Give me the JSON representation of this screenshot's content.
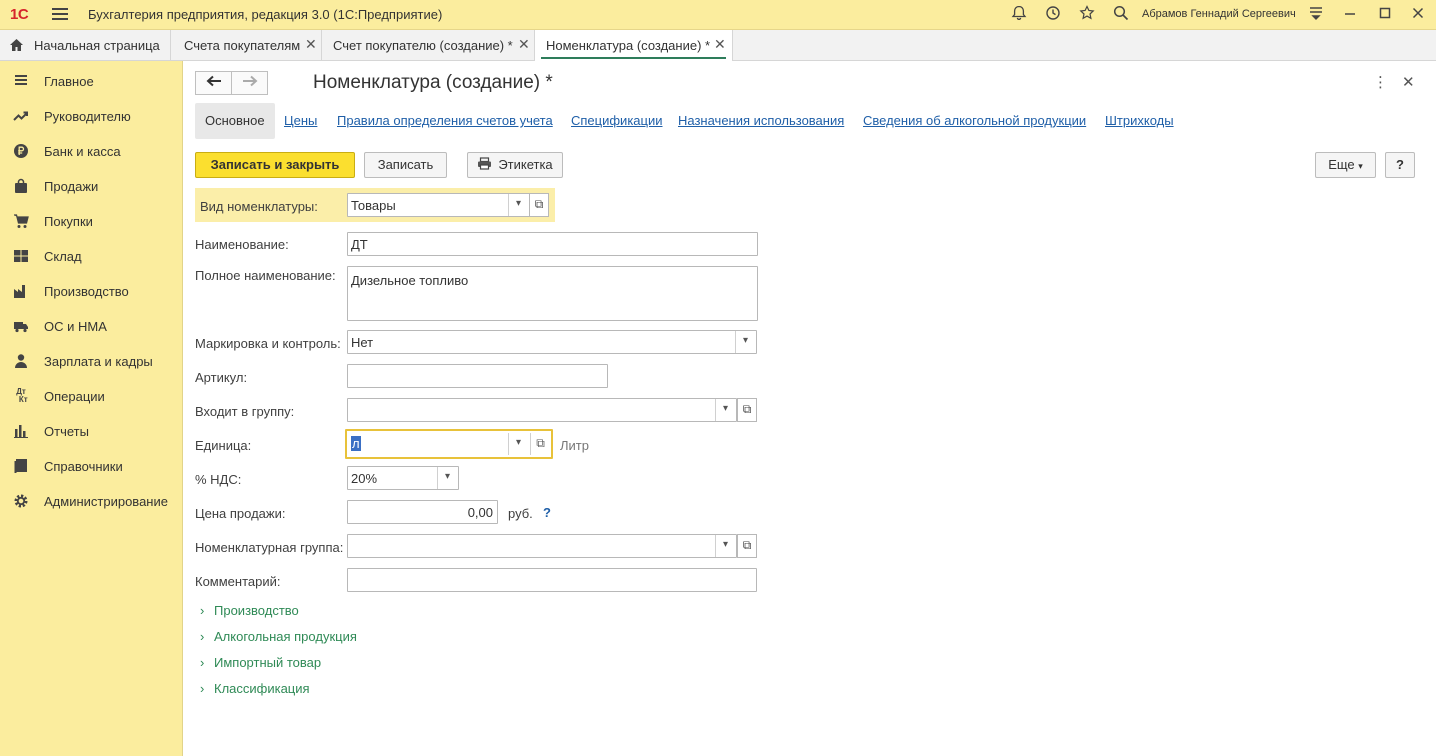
{
  "app": {
    "logo": "1С",
    "title": "Бухгалтерия предприятия, редакция 3.0  (1С:Предприятие)",
    "user": "Абрамов Геннадий Сергеевич"
  },
  "tabs": [
    {
      "label": "Начальная страница"
    },
    {
      "label": "Счета покупателям"
    },
    {
      "label": "Счет покупателю (создание) *"
    },
    {
      "label": "Номенклатура (создание) *"
    }
  ],
  "sidebar": {
    "items": [
      {
        "label": "Главное",
        "icon": "menu-icon"
      },
      {
        "label": "Руководителю",
        "icon": "trend-icon"
      },
      {
        "label": "Банк и касса",
        "icon": "ruble-icon"
      },
      {
        "label": "Продажи",
        "icon": "bag-icon"
      },
      {
        "label": "Покупки",
        "icon": "cart-icon"
      },
      {
        "label": "Склад",
        "icon": "warehouse-icon"
      },
      {
        "label": "Производство",
        "icon": "factory-icon"
      },
      {
        "label": "ОС и НМА",
        "icon": "truck-icon"
      },
      {
        "label": "Зарплата и кадры",
        "icon": "person-icon"
      },
      {
        "label": "Операции",
        "icon": "dt-kt-icon"
      },
      {
        "label": "Отчеты",
        "icon": "bar-chart-icon"
      },
      {
        "label": "Справочники",
        "icon": "book-icon"
      },
      {
        "label": "Администрирование",
        "icon": "gear-icon"
      }
    ]
  },
  "form": {
    "title": "Номенклатура (создание) *",
    "tabs": [
      "Основное",
      "Цены",
      "Правила определения счетов учета",
      "Спецификации",
      "Назначения использования",
      "Сведения об алкогольной продукции",
      "Штрихкоды"
    ],
    "buttons": {
      "save_close": "Записать и закрыть",
      "save": "Записать",
      "label": "Этикетка",
      "more": "Еще",
      "help": "?"
    },
    "fields": {
      "kind_label": "Вид номенклатуры:",
      "kind_value": "Товары",
      "name_label": "Наименование:",
      "name_value": "ДТ",
      "full_name_label": "Полное наименование:",
      "full_name_value": "Дизельное топливо",
      "marking_label": "Маркировка и контроль:",
      "marking_value": "Нет",
      "article_label": "Артикул:",
      "article_value": "",
      "group_label": "Входит в группу:",
      "group_value": "",
      "unit_label": "Единица:",
      "unit_value": "л",
      "unit_hint": "Литр",
      "vat_label": "% НДС:",
      "vat_value": "20%",
      "price_label": "Цена продажи:",
      "price_value": "0,00",
      "price_currency": "руб.",
      "price_help": "?",
      "nom_group_label": "Номенклатурная группа:",
      "nom_group_value": "",
      "comment_label": "Комментарий:",
      "comment_value": ""
    },
    "sections": [
      "Производство",
      "Алкогольная продукция",
      "Импортный товар",
      "Классификация"
    ]
  }
}
